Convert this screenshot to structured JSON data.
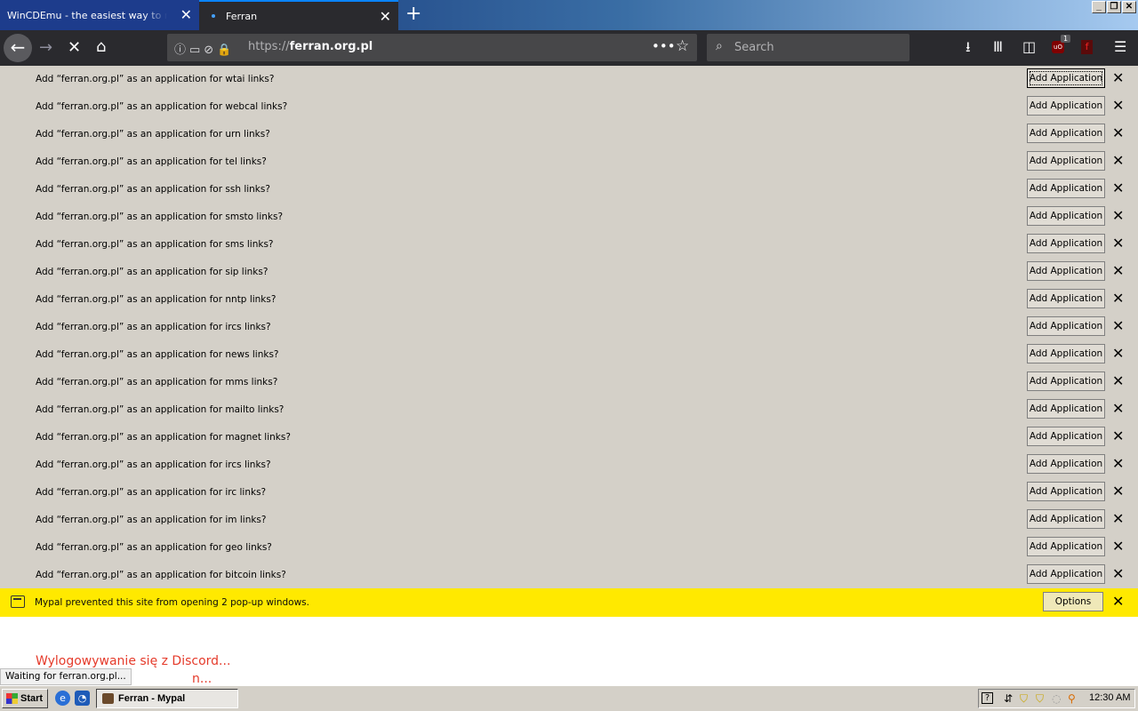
{
  "tabs": [
    {
      "title": "WinCDEmu - the easiest way to mount",
      "active": false
    },
    {
      "title": "Ferran",
      "active": true
    }
  ],
  "window_controls": {
    "minimize": "_",
    "restore": "❐",
    "close": "✕"
  },
  "navbar": {
    "url_prefix": "https://",
    "url_domain": "ferran.org.pl",
    "search_placeholder": "Search",
    "ublock_badge": "1"
  },
  "notifications": [
    {
      "message": "Add “ferran.org.pl” as an application for wtai links?",
      "button": "Add Application",
      "focused": true
    },
    {
      "message": "Add “ferran.org.pl” as an application for webcal links?",
      "button": "Add Application"
    },
    {
      "message": "Add “ferran.org.pl” as an application for urn links?",
      "button": "Add Application"
    },
    {
      "message": "Add “ferran.org.pl” as an application for tel links?",
      "button": "Add Application"
    },
    {
      "message": "Add “ferran.org.pl” as an application for ssh links?",
      "button": "Add Application"
    },
    {
      "message": "Add “ferran.org.pl” as an application for smsto links?",
      "button": "Add Application"
    },
    {
      "message": "Add “ferran.org.pl” as an application for sms links?",
      "button": "Add Application"
    },
    {
      "message": "Add “ferran.org.pl” as an application for sip links?",
      "button": "Add Application"
    },
    {
      "message": "Add “ferran.org.pl” as an application for nntp links?",
      "button": "Add Application"
    },
    {
      "message": "Add “ferran.org.pl” as an application for ircs links?",
      "button": "Add Application"
    },
    {
      "message": "Add “ferran.org.pl” as an application for news links?",
      "button": "Add Application"
    },
    {
      "message": "Add “ferran.org.pl” as an application for mms links?",
      "button": "Add Application"
    },
    {
      "message": "Add “ferran.org.pl” as an application for mailto links?",
      "button": "Add Application"
    },
    {
      "message": "Add “ferran.org.pl” as an application for magnet links?",
      "button": "Add Application"
    },
    {
      "message": "Add “ferran.org.pl” as an application for ircs links?",
      "button": "Add Application"
    },
    {
      "message": "Add “ferran.org.pl” as an application for irc links?",
      "button": "Add Application"
    },
    {
      "message": "Add “ferran.org.pl” as an application for im links?",
      "button": "Add Application"
    },
    {
      "message": "Add “ferran.org.pl” as an application for geo links?",
      "button": "Add Application"
    },
    {
      "message": "Add “ferran.org.pl” as an application for bitcoin links?",
      "button": "Add Application"
    }
  ],
  "popup_bar": {
    "message": "Mypal prevented this site from opening 2 pop-up windows.",
    "options_label": "Options"
  },
  "page": {
    "link1": "Wylogowywanie się z Discord...",
    "link2": "n..."
  },
  "status_text": "Waiting for ferran.org.pl...",
  "taskbar": {
    "start_label": "Start",
    "task_item": "Ferran - Mypal",
    "clock": "12:30 AM"
  }
}
